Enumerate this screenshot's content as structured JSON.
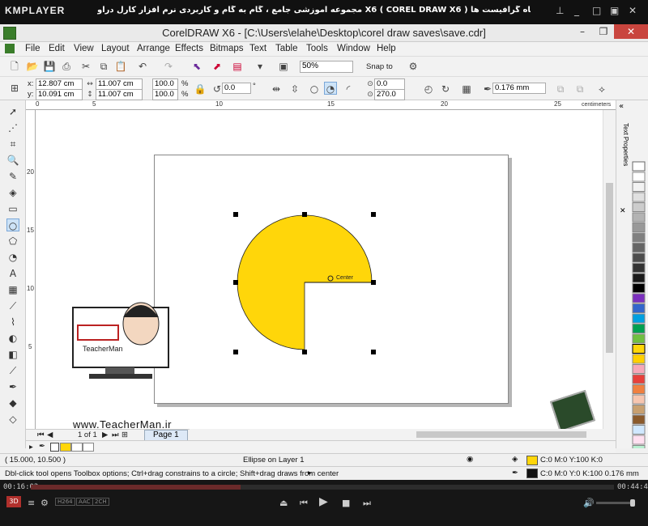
{
  "player": {
    "logo": "KMPLAYER",
    "title": "مجموعه آموزشی جامع ، گام به گام و کاربردی نرم افزار کارل دراو X6 ( COREL DRAW X6 ) مدرس : سعید فدایی (تیچرمن) گروه آموزشی پادشاه گرافیست ها",
    "time_elapsed": "00:16:02",
    "time_total": "00:44:44",
    "progress": 0.36,
    "badges": [
      "H264",
      "AAC",
      "2CH"
    ],
    "three_d_label": "3D"
  },
  "window": {
    "title": "CorelDRAW X6 - [C:\\Users\\elahe\\Desktop\\corel draw saves\\save.cdr]",
    "minimize": "–",
    "maximize": "❐",
    "close": "✕"
  },
  "menu": [
    "File",
    "Edit",
    "View",
    "Layout",
    "Arrange",
    "Effects",
    "Bitmaps",
    "Text",
    "Table",
    "Tools",
    "Window",
    "Help"
  ],
  "toolbar": {
    "zoom": "50%",
    "snap_to": "Snap to"
  },
  "propertybar": {
    "x": "12.807 cm",
    "y": "10.091 cm",
    "width": "11.007 cm",
    "height": "11.007 cm",
    "scale_x": "100.0",
    "scale_y": "100.0",
    "percent": "%",
    "rotation": "0.0",
    "degree": "°",
    "start_angle": "0.0",
    "end_angle": "270.0",
    "outline_width": "0.176 mm",
    "x_label": "x:",
    "y_label": "y:"
  },
  "rulers": {
    "top": [
      "0",
      "5",
      "10",
      "15",
      "20",
      "25"
    ],
    "left": [
      "20",
      "15",
      "10",
      "5"
    ],
    "unit": "centimeters"
  },
  "docker": {
    "tab": "Text Properties"
  },
  "pagenav": {
    "count": "1 of 1",
    "page_tab": "Page 1"
  },
  "status": {
    "coords": "( 15.000, 10.500 )",
    "object": "Ellipse on Layer 1",
    "hint": "Dbl-click tool opens Toolbox options; Ctrl+drag constrains to a circle; Shift+drag draws from center",
    "fill_info": "C:0 M:0 Y:100 K:0",
    "outline_info": "C:0 M:0 Y:0 K:100  0.176 mm"
  },
  "canvas": {
    "center_label": "Center",
    "shape_color": "#FFD60A"
  },
  "watermark": {
    "url": "www.TeacherMan.ir",
    "name": "TeacherMan"
  },
  "palette": [
    "#ffffff",
    "#f2f2f2",
    "#e0e0e0",
    "#cccccc",
    "#b3b3b3",
    "#999999",
    "#808080",
    "#666666",
    "#4d4d4d",
    "#333333",
    "#1a1a1a",
    "#000000",
    "#7b2fbe",
    "#3366cc",
    "#00a0e0",
    "#00a050",
    "#70c040",
    "#ffd60a",
    "#ffd000",
    "#f7a8b8",
    "#e8403a",
    "#f08040",
    "#f7c6b0",
    "#c8a070",
    "#8b5a2b",
    "#d0e8ff",
    "#ffe0f0",
    "#b8f0d0",
    "#fff6b0"
  ]
}
